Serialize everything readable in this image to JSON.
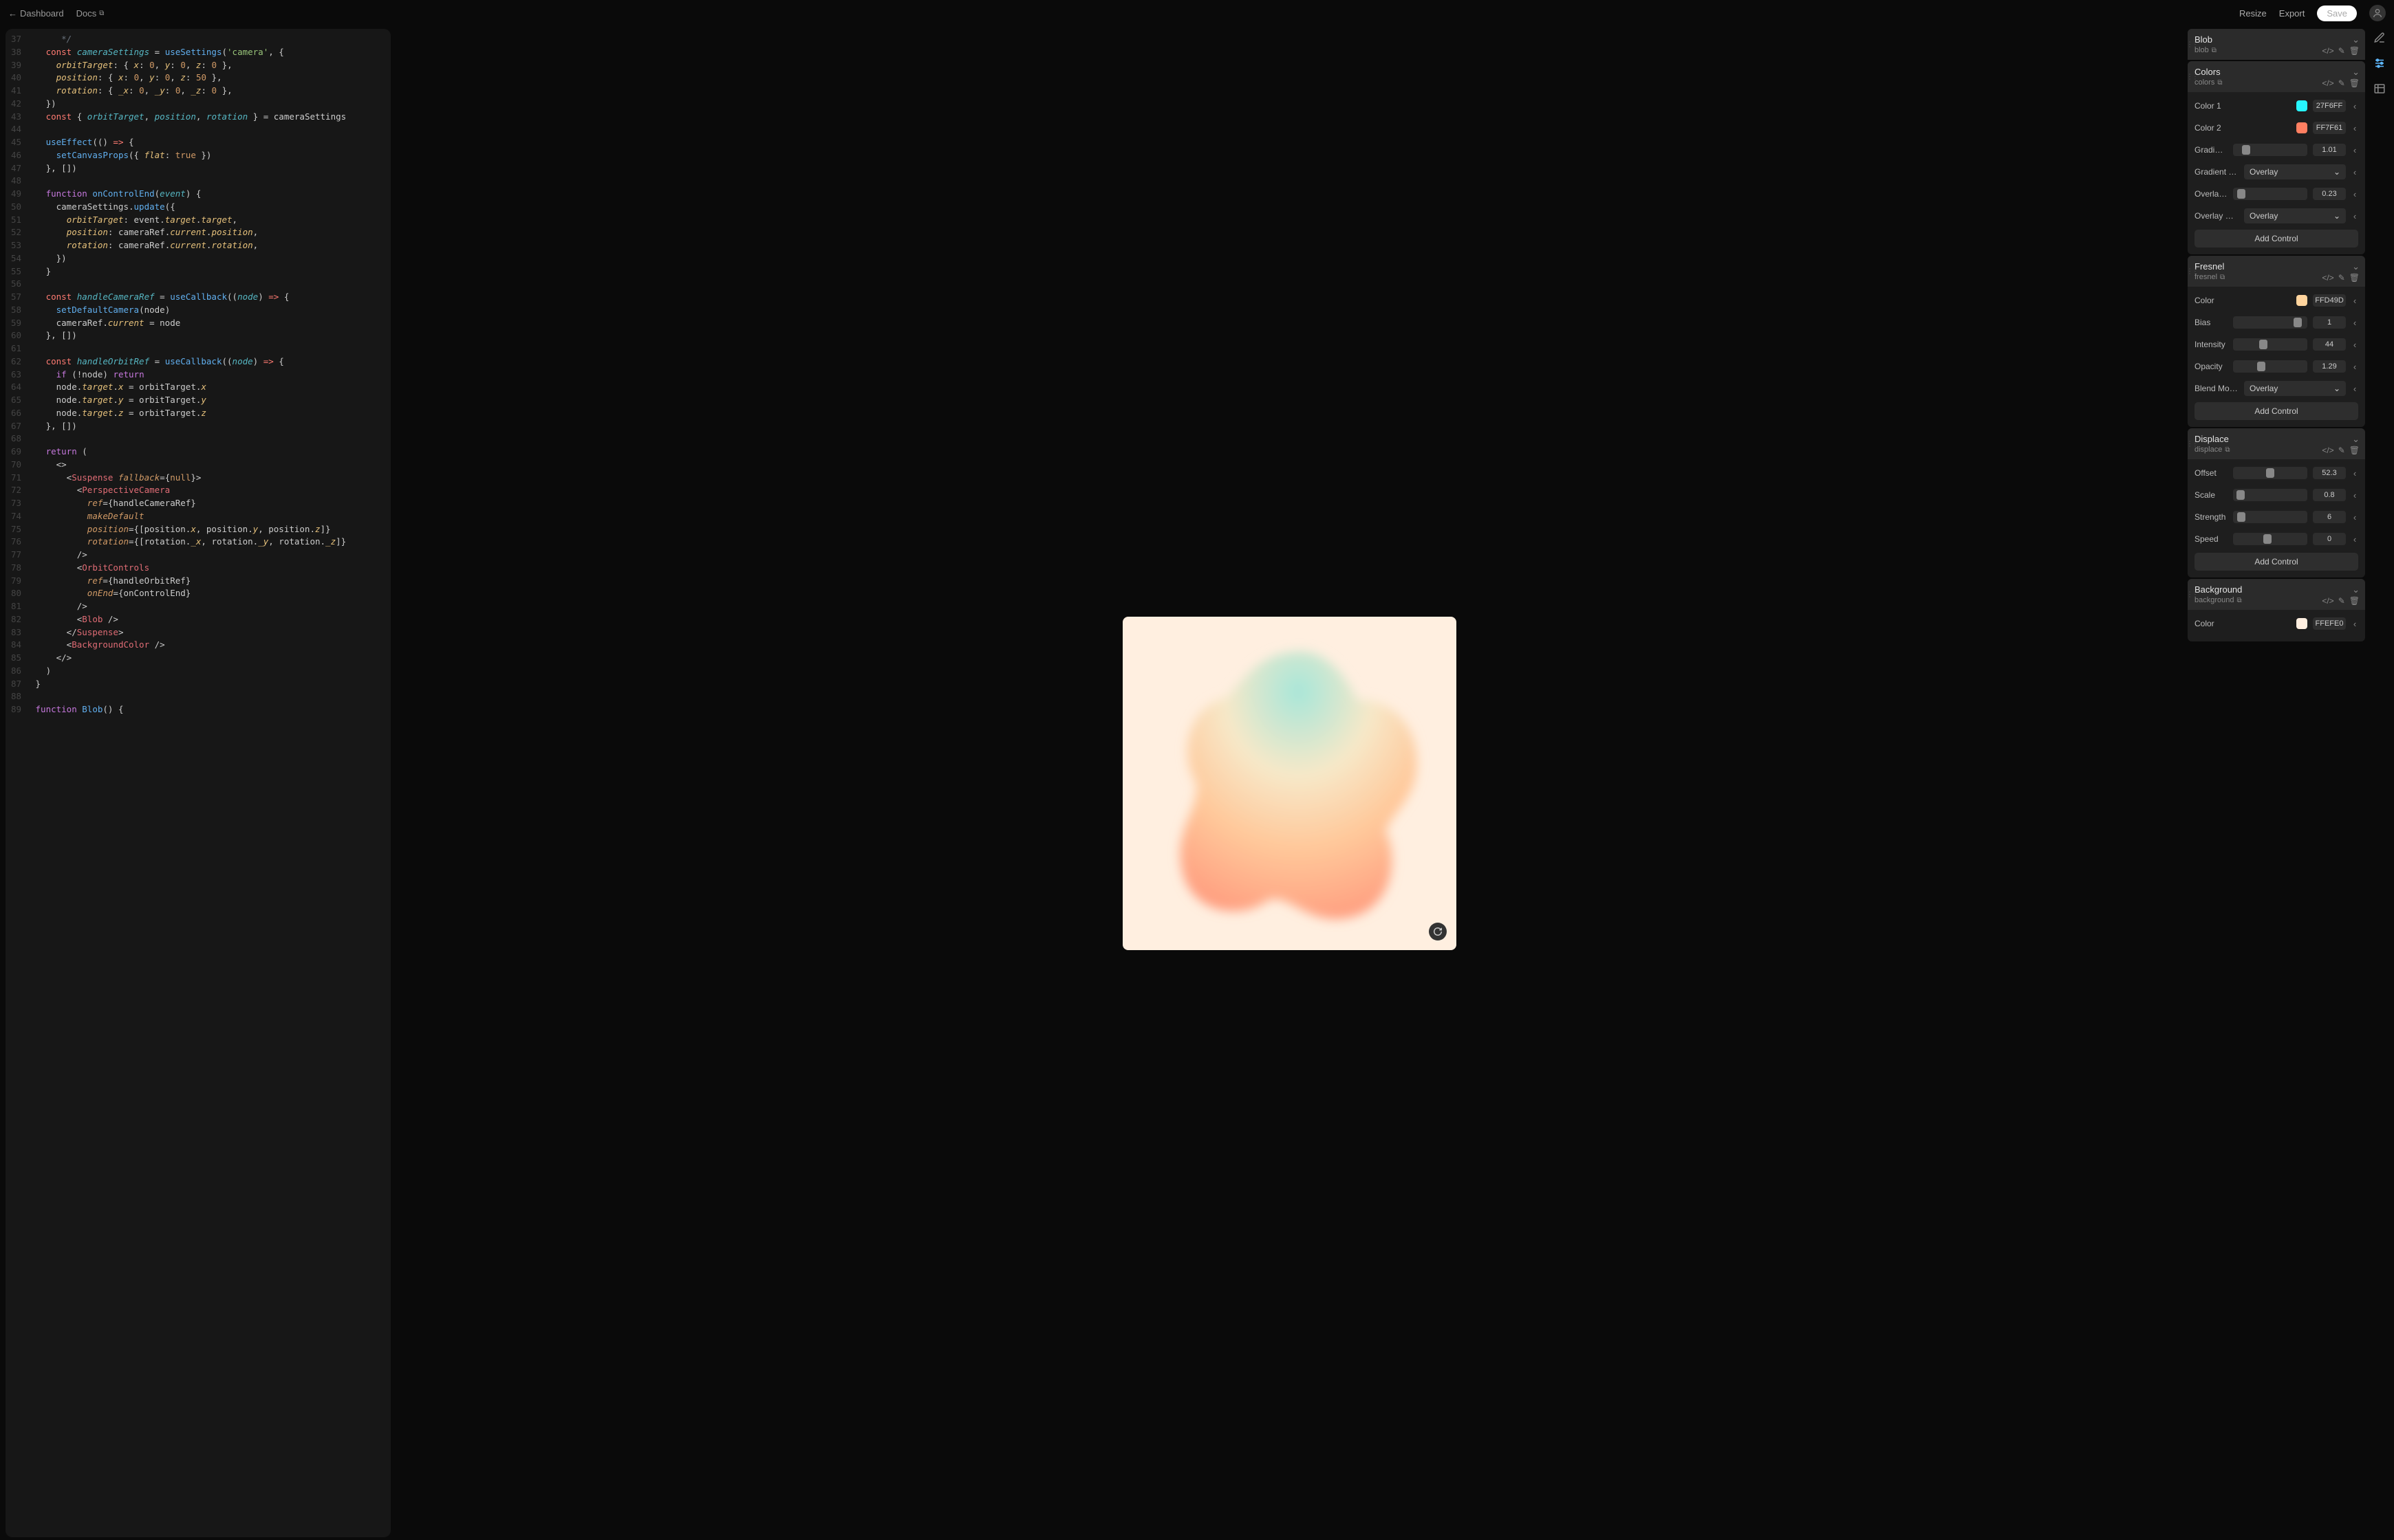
{
  "topbar": {
    "dashboard": "Dashboard",
    "docs": "Docs",
    "resize": "Resize",
    "export": "Export",
    "save": "Save"
  },
  "panels": [
    {
      "title": "Blob",
      "sub": "blob",
      "actions": [
        "code",
        "edit",
        "delete"
      ],
      "rows": []
    },
    {
      "title": "Colors",
      "sub": "colors",
      "actions": [
        "code",
        "edit",
        "delete"
      ],
      "rows": [
        {
          "label": "Color 1",
          "type": "color",
          "swatch": "#27F6FF",
          "value": "27F6FF"
        },
        {
          "label": "Color 2",
          "type": "color",
          "swatch": "#FF7F61",
          "value": "FF7F61"
        },
        {
          "label": "Gradient Intensi…",
          "type": "slider",
          "pos": 0.14,
          "value": "1.01"
        },
        {
          "label": "Gradient Blend …",
          "type": "select",
          "value": "Overlay"
        },
        {
          "label": "Overlay Opacity",
          "type": "slider",
          "pos": 0.06,
          "value": "0.23"
        },
        {
          "label": "Overlay Blend …",
          "type": "select",
          "value": "Overlay"
        }
      ],
      "add": "Add Control"
    },
    {
      "title": "Fresnel",
      "sub": "fresnel",
      "actions": [
        "code",
        "edit",
        "delete"
      ],
      "rows": [
        {
          "label": "Color",
          "type": "color",
          "swatch": "#FFD49D",
          "value": "FFD49D"
        },
        {
          "label": "Bias",
          "type": "slider",
          "pos": 0.92,
          "value": "1"
        },
        {
          "label": "Intensity",
          "type": "slider",
          "pos": 0.4,
          "value": "44"
        },
        {
          "label": "Opacity",
          "type": "slider",
          "pos": 0.36,
          "value": "1.29"
        },
        {
          "label": "Blend Mode",
          "type": "select",
          "value": "Overlay"
        }
      ],
      "add": "Add Control"
    },
    {
      "title": "Displace",
      "sub": "displace",
      "actions": [
        "code",
        "edit",
        "delete"
      ],
      "rows": [
        {
          "label": "Offset",
          "type": "slider",
          "pos": 0.5,
          "value": "52.3"
        },
        {
          "label": "Scale",
          "type": "slider",
          "pos": 0.05,
          "value": "0.8"
        },
        {
          "label": "Strength",
          "type": "slider",
          "pos": 0.06,
          "value": "6"
        },
        {
          "label": "Speed",
          "type": "slider",
          "pos": 0.46,
          "value": "0"
        }
      ],
      "add": "Add Control"
    },
    {
      "title": "Background",
      "sub": "background",
      "actions": [
        "code",
        "edit",
        "delete"
      ],
      "rows": [
        {
          "label": "Color",
          "type": "color",
          "swatch": "#FFEFE0",
          "value": "FFEFE0"
        }
      ]
    }
  ],
  "code": [
    {
      "n": 37,
      "t": "      */",
      "cls": "c-comment"
    },
    {
      "n": 38,
      "h": "   <span class='c-kw'>const</span> <span class='c-var'>cameraSettings</span> = <span class='c-fn'>useSettings</span>(<span class='c-str'>'camera'</span>, {"
    },
    {
      "n": 39,
      "h": "     <span class='c-prop'>orbitTarget</span>: { <span class='c-prop'>x</span>: <span class='c-num'>0</span>, <span class='c-prop'>y</span>: <span class='c-num'>0</span>, <span class='c-prop'>z</span>: <span class='c-num'>0</span> },"
    },
    {
      "n": 40,
      "h": "     <span class='c-prop'>position</span>: { <span class='c-prop'>x</span>: <span class='c-num'>0</span>, <span class='c-prop'>y</span>: <span class='c-num'>0</span>, <span class='c-prop'>z</span>: <span class='c-num'>50</span> },"
    },
    {
      "n": 41,
      "h": "     <span class='c-prop'>rotation</span>: { <span class='c-prop'>_x</span>: <span class='c-num'>0</span>, <span class='c-prop'>_y</span>: <span class='c-num'>0</span>, <span class='c-prop'>_z</span>: <span class='c-num'>0</span> },"
    },
    {
      "n": 42,
      "h": "   })"
    },
    {
      "n": 43,
      "h": "   <span class='c-kw'>const</span> { <span class='c-var'>orbitTarget</span>, <span class='c-var'>position</span>, <span class='c-var'>rotation</span> } = cameraSettings"
    },
    {
      "n": 44,
      "h": ""
    },
    {
      "n": 45,
      "h": "   <span class='c-fn'>useEffect</span>(() <span class='c-kw'>=&gt;</span> {"
    },
    {
      "n": 46,
      "h": "     <span class='c-fn'>setCanvasProps</span>({ <span class='c-prop'>flat</span>: <span class='c-num'>true</span> })"
    },
    {
      "n": 47,
      "h": "   }, [])"
    },
    {
      "n": 48,
      "h": ""
    },
    {
      "n": 49,
      "h": "   <span class='c-kw2'>function</span> <span class='c-fn'>onControlEnd</span>(<span class='c-var'>event</span>) {"
    },
    {
      "n": 50,
      "h": "     cameraSettings.<span class='c-fn'>update</span>({"
    },
    {
      "n": 51,
      "h": "       <span class='c-prop'>orbitTarget</span>: event.<span class='c-prop'>target</span>.<span class='c-prop'>target</span>,"
    },
    {
      "n": 52,
      "h": "       <span class='c-prop'>position</span>: cameraRef.<span class='c-prop'>current</span>.<span class='c-prop'>position</span>,"
    },
    {
      "n": 53,
      "h": "       <span class='c-prop'>rotation</span>: cameraRef.<span class='c-prop'>current</span>.<span class='c-prop'>rotation</span>,"
    },
    {
      "n": 54,
      "h": "     })"
    },
    {
      "n": 55,
      "h": "   }"
    },
    {
      "n": 56,
      "h": ""
    },
    {
      "n": 57,
      "h": "   <span class='c-kw'>const</span> <span class='c-var'>handleCameraRef</span> = <span class='c-fn'>useCallback</span>((<span class='c-var'>node</span>) <span class='c-kw'>=&gt;</span> {"
    },
    {
      "n": 58,
      "h": "     <span class='c-fn'>setDefaultCamera</span>(node)"
    },
    {
      "n": 59,
      "h": "     cameraRef.<span class='c-prop'>current</span> = node"
    },
    {
      "n": 60,
      "h": "   }, [])"
    },
    {
      "n": 61,
      "h": ""
    },
    {
      "n": 62,
      "h": "   <span class='c-kw'>const</span> <span class='c-var'>handleOrbitRef</span> = <span class='c-fn'>useCallback</span>((<span class='c-var'>node</span>) <span class='c-kw'>=&gt;</span> {"
    },
    {
      "n": 63,
      "h": "     <span class='c-kw2'>if</span> (!node) <span class='c-kw2'>return</span>"
    },
    {
      "n": 64,
      "h": "     node.<span class='c-prop'>target</span>.<span class='c-prop'>x</span> = orbitTarget.<span class='c-prop'>x</span>"
    },
    {
      "n": 65,
      "h": "     node.<span class='c-prop'>target</span>.<span class='c-prop'>y</span> = orbitTarget.<span class='c-prop'>y</span>"
    },
    {
      "n": 66,
      "h": "     node.<span class='c-prop'>target</span>.<span class='c-prop'>z</span> = orbitTarget.<span class='c-prop'>z</span>"
    },
    {
      "n": 67,
      "h": "   }, [])"
    },
    {
      "n": 68,
      "h": ""
    },
    {
      "n": 69,
      "h": "   <span class='c-kw2'>return</span> ("
    },
    {
      "n": 70,
      "h": "     &lt;&gt;"
    },
    {
      "n": 71,
      "h": "       &lt;<span class='c-tag'>Suspense</span> <span class='c-attr'>fallback</span>={<span class='c-null'>null</span>}&gt;"
    },
    {
      "n": 72,
      "h": "         &lt;<span class='c-tag'>PerspectiveCamera</span>"
    },
    {
      "n": 73,
      "h": "           <span class='c-attr'>ref</span>={handleCameraRef}"
    },
    {
      "n": 74,
      "h": "           <span class='c-attr'>makeDefault</span>"
    },
    {
      "n": 75,
      "h": "           <span class='c-attr'>position</span>={[position.<span class='c-prop'>x</span>, position.<span class='c-prop'>y</span>, position.<span class='c-prop'>z</span>]}"
    },
    {
      "n": 76,
      "h": "           <span class='c-attr'>rotation</span>={[rotation.<span class='c-prop'>_x</span>, rotation.<span class='c-prop'>_y</span>, rotation.<span class='c-prop'>_z</span>]}"
    },
    {
      "n": 77,
      "h": "         /&gt;"
    },
    {
      "n": 78,
      "h": "         &lt;<span class='c-tag'>OrbitControls</span>"
    },
    {
      "n": 79,
      "h": "           <span class='c-attr'>ref</span>={handleOrbitRef}"
    },
    {
      "n": 80,
      "h": "           <span class='c-attr'>onEnd</span>={onControlEnd}"
    },
    {
      "n": 81,
      "h": "         /&gt;"
    },
    {
      "n": 82,
      "h": "         &lt;<span class='c-tag'>Blob</span> /&gt;"
    },
    {
      "n": 83,
      "h": "       &lt;/<span class='c-tag'>Suspense</span>&gt;"
    },
    {
      "n": 84,
      "h": "       &lt;<span class='c-tag'>BackgroundColor</span> /&gt;"
    },
    {
      "n": 85,
      "h": "     &lt;/&gt;"
    },
    {
      "n": 86,
      "h": "   )"
    },
    {
      "n": 87,
      "h": " }"
    },
    {
      "n": 88,
      "h": ""
    },
    {
      "n": 89,
      "h": " <span class='c-kw2'>function</span> <span class='c-fn'>Blob</span>() {"
    }
  ]
}
